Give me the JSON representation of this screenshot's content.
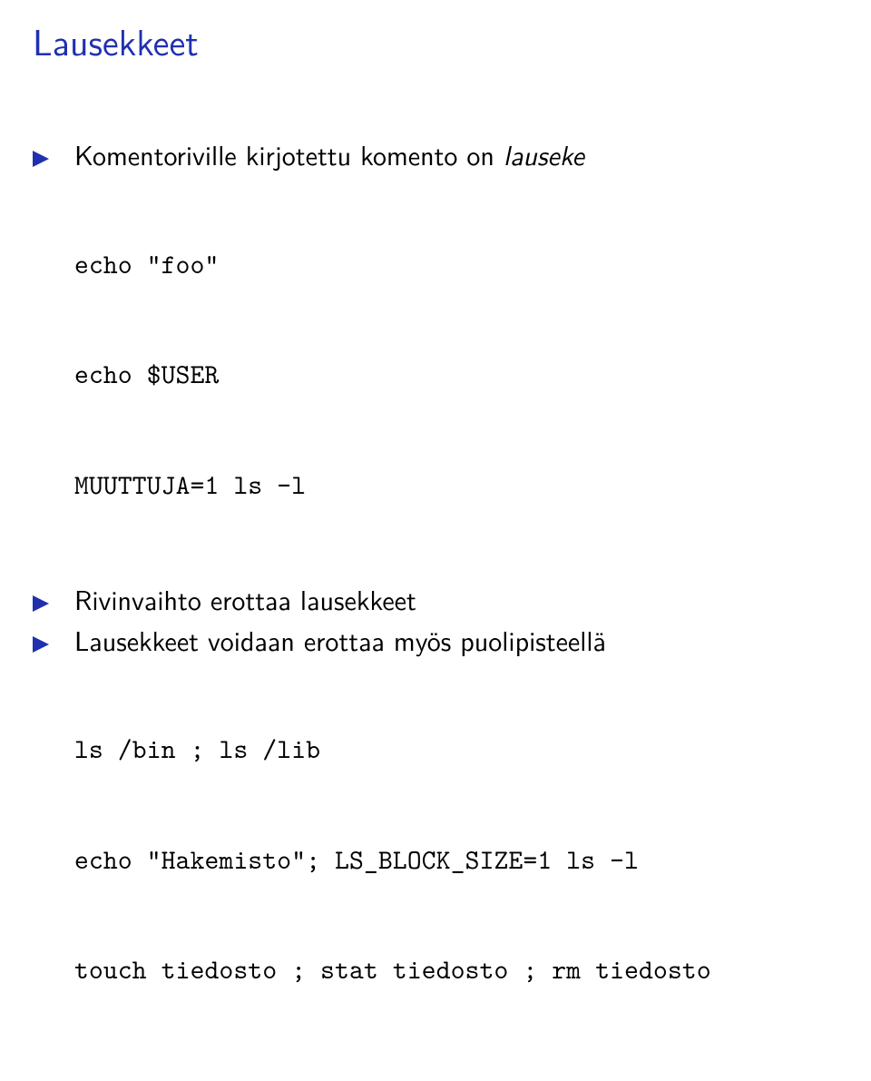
{
  "title": "Lausekkeet",
  "bullets": [
    {
      "text_prefix": "Komentoriville kirjotettu komento on ",
      "text_italic": "lauseke",
      "code": [
        "echo \"foo\"",
        "echo $USER",
        "MUUTTUJA=1 ls -l"
      ]
    },
    {
      "text_prefix": "Rivinvaihto erottaa lausekkeet",
      "text_italic": "",
      "code": []
    },
    {
      "text_prefix": "Lausekkeet voidaan erottaa myös puolipisteellä",
      "text_italic": "",
      "code": [
        "ls /bin ; ls /lib",
        "echo \"Hakemisto\"; LS_BLOCK_SIZE=1 ls -l",
        "touch tiedosto ; stat tiedosto ; rm tiedosto"
      ]
    }
  ]
}
